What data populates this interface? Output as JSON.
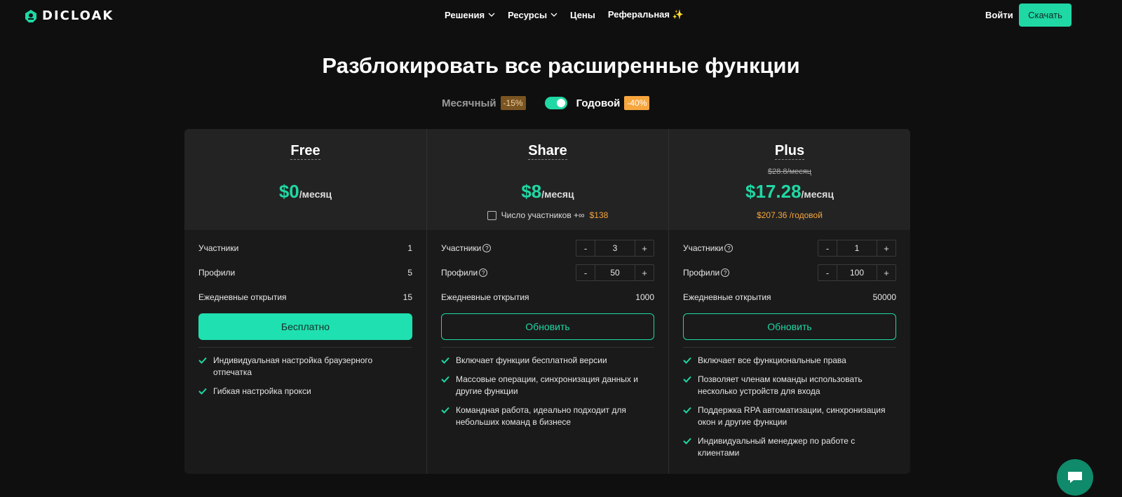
{
  "header": {
    "logo_text": "DICLOAK",
    "nav": [
      "Решения",
      "Ресурсы",
      "Цены",
      "Реферальная ✨"
    ],
    "login": "Войти",
    "download": "Скачать"
  },
  "title": "Разблокировать все расширенные функции",
  "billing": {
    "monthly": "Месячный",
    "monthly_discount": "-15%",
    "yearly": "Годовой",
    "yearly_discount": "-40%",
    "yearly_selected": true
  },
  "plans": [
    {
      "name": "Free",
      "price": "$0",
      "per": "/месяц",
      "rows": [
        {
          "label": "Участники",
          "value": "1"
        },
        {
          "label": "Профили",
          "value": "5"
        },
        {
          "label": "Ежедневные открытия",
          "value": "15"
        }
      ],
      "cta": "Бесплатно",
      "features": [
        "Индивидуальная настройка браузерного отпечатка",
        "Гибкая настройка прокси"
      ]
    },
    {
      "name": "Share",
      "price": "$8",
      "per": "/месяц",
      "members_option": "Число участников +∞",
      "members_option_price": "$138",
      "rows": [
        {
          "label": "Участники",
          "value": "3"
        },
        {
          "label": "Профили",
          "value": "50"
        },
        {
          "label": "Ежедневные открытия",
          "value": "1000"
        }
      ],
      "cta": "Обновить",
      "features": [
        "Включает функции бесплатной версии",
        "Массовые операции, синхронизация данных и другие функции",
        "Командная работа, идеально подходит для небольших команд в бизнесе"
      ]
    },
    {
      "name": "Plus",
      "old_price": "$28.8/месяц",
      "price": "$17.28",
      "per": "/месяц",
      "yearly_total": "$207.36 /годовой",
      "rows": [
        {
          "label": "Участники",
          "value": "1"
        },
        {
          "label": "Профили",
          "value": "100"
        },
        {
          "label": "Ежедневные открытия",
          "value": "50000"
        }
      ],
      "cta": "Обновить",
      "features": [
        "Включает все функциональные права",
        "Позволяет членам команды использовать несколько устройств для входа",
        "Поддержка RPA автоматизации, синхронизация окон и другие функции",
        "Индивидуальный менеджер по работе с клиентами"
      ]
    }
  ],
  "stepper": {
    "minus": "-",
    "plus": "+",
    "help": "?"
  },
  "colors": {
    "accent": "#1fd8a4",
    "orange": "#f7a63e",
    "background": "#0f0f0f"
  }
}
